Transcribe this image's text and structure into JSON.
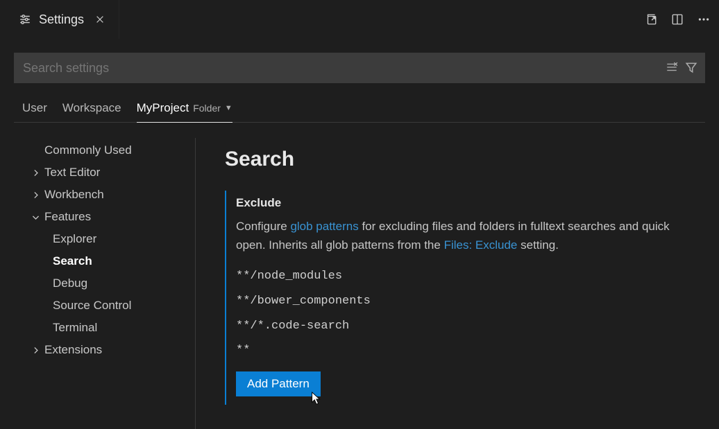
{
  "tab": {
    "title": "Settings"
  },
  "search": {
    "placeholder": "Search settings"
  },
  "scopes": {
    "user": "User",
    "workspace": "Workspace",
    "folder_name": "MyProject",
    "folder_suffix": "Folder"
  },
  "tree": {
    "commonly_used": "Commonly Used",
    "text_editor": "Text Editor",
    "workbench": "Workbench",
    "features": "Features",
    "explorer": "Explorer",
    "search": "Search",
    "debug": "Debug",
    "source_control": "Source Control",
    "terminal": "Terminal",
    "extensions": "Extensions"
  },
  "detail": {
    "heading": "Search",
    "setting_name": "Exclude",
    "desc_pre": "Configure ",
    "desc_link1": "glob patterns",
    "desc_mid": " for excluding files and folders in fulltext searches and quick open. Inherits all glob patterns from the ",
    "desc_link2": "Files: Exclude",
    "desc_post": " setting.",
    "patterns": [
      "**/node_modules",
      "**/bower_components",
      "**/*.code-search",
      "**"
    ],
    "add_button": "Add Pattern"
  }
}
